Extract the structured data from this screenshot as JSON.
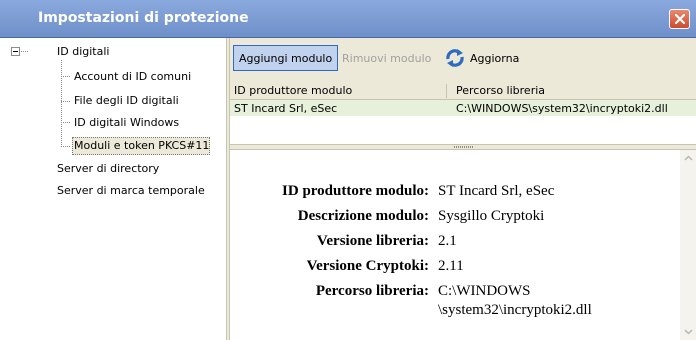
{
  "window": {
    "title": "Impostazioni di protezione"
  },
  "sidebar": {
    "root": "ID digitali",
    "children": [
      "Account di ID comuni",
      "File degli ID digitali",
      "ID digitali Windows",
      "Moduli e token PKCS#11"
    ],
    "others": [
      "Server di directory",
      "Server di marca temporale"
    ]
  },
  "toolbar": {
    "add_label": "Aggiungi modulo",
    "remove_label": "Rimuovi modulo",
    "refresh_label": "Aggiorna"
  },
  "table": {
    "columns": [
      "ID produttore modulo",
      "Percorso libreria"
    ],
    "rows": [
      [
        "ST Incard Srl, eSec",
        "C:\\WINDOWS\\system32\\incryptoki2.dll"
      ]
    ]
  },
  "details": {
    "labels": [
      "ID produttore modulo:",
      "Descrizione modulo:",
      "Versione libreria:",
      "Versione Cryptoki:",
      "Percorso libreria:"
    ],
    "values": {
      "manufacturer": "ST Incard Srl, eSec",
      "description": "Sysgillo Cryptoki",
      "library_version": "2.1",
      "cryptoki_version": "2.11",
      "path_line1": "C:\\WINDOWS",
      "path_line2": "\\system32\\incryptoki2.dll"
    }
  },
  "colors": {
    "title_bar": "#7c9bd3",
    "selection_row": "#e6f0da",
    "toolbar_bg": "#ece9d8",
    "close_button": "#d8563a"
  }
}
